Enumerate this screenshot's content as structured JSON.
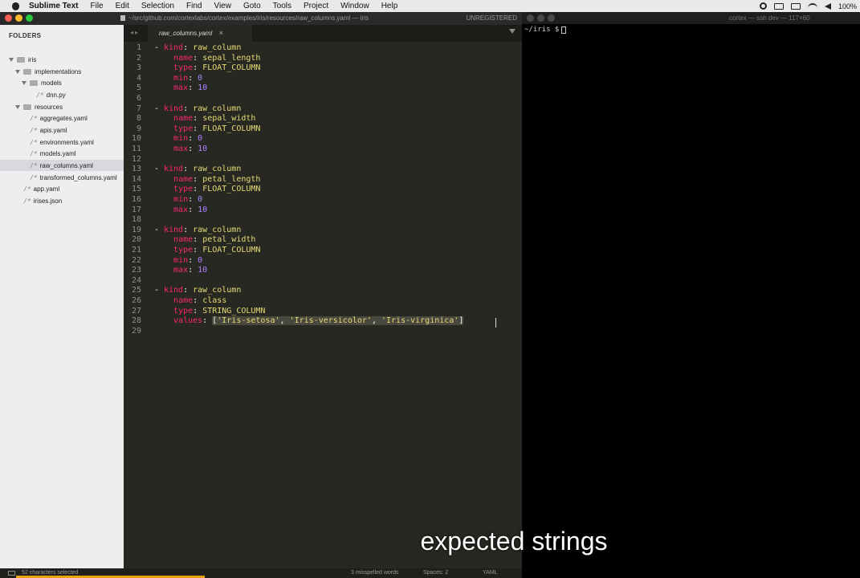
{
  "menubar": {
    "items": [
      "Sublime Text",
      "File",
      "Edit",
      "Selection",
      "Find",
      "View",
      "Goto",
      "Tools",
      "Project",
      "Window",
      "Help"
    ],
    "battery": "100%"
  },
  "sublime": {
    "title": "~/src/github.com/cortexlabs/cortex/examples/iris/resources/raw_columns.yaml — iris",
    "unregistered": "UNREGISTERED",
    "sidebar": {
      "header": "FOLDERS",
      "items": [
        {
          "label": "iris",
          "kind": "folder"
        },
        {
          "label": "implementations",
          "kind": "folder"
        },
        {
          "label": "models",
          "kind": "folder"
        },
        {
          "label": "dnn.py",
          "kind": "file"
        },
        {
          "label": "resources",
          "kind": "folder"
        },
        {
          "label": "aggregates.yaml",
          "kind": "file"
        },
        {
          "label": "apis.yaml",
          "kind": "file"
        },
        {
          "label": "environments.yaml",
          "kind": "file"
        },
        {
          "label": "models.yaml",
          "kind": "file"
        },
        {
          "label": "raw_columns.yaml",
          "kind": "file",
          "selected": true
        },
        {
          "label": "transformed_columns.yaml",
          "kind": "file"
        },
        {
          "label": "app.yaml",
          "kind": "file"
        },
        {
          "label": "irises.json",
          "kind": "file"
        }
      ]
    },
    "tab": {
      "label": "raw_columns.yaml",
      "close": "×"
    },
    "editor": {
      "line_numbers": [
        "1",
        "2",
        "3",
        "4",
        "5",
        "6",
        "7",
        "8",
        "9",
        "10",
        "11",
        "12",
        "13",
        "14",
        "15",
        "16",
        "17",
        "18",
        "19",
        "20",
        "21",
        "22",
        "23",
        "24",
        "25",
        "26",
        "27",
        "28",
        "29"
      ],
      "keys": {
        "kind": "kind",
        "name": "name",
        "type": "type",
        "min": "min",
        "max": "max",
        "values": "values"
      },
      "blocks": [
        {
          "kind": "raw_column",
          "name": "sepal_length",
          "type": "FLOAT_COLUMN",
          "min": "0",
          "max": "10"
        },
        {
          "kind": "raw_column",
          "name": "sepal_width",
          "type": "FLOAT_COLUMN",
          "min": "0",
          "max": "10"
        },
        {
          "kind": "raw_column",
          "name": "petal_length",
          "type": "FLOAT_COLUMN",
          "min": "0",
          "max": "10"
        },
        {
          "kind": "raw_column",
          "name": "petal_width",
          "type": "FLOAT_COLUMN",
          "min": "0",
          "max": "10"
        },
        {
          "kind": "raw_column",
          "name": "class",
          "type": "STRING_COLUMN"
        }
      ],
      "values_line": {
        "open": "[",
        "v1": "'Iris-setosa'",
        "v2": "'Iris-versicolor'",
        "v3": "'Iris-virginica'",
        "close": "]",
        "sep": ", "
      }
    },
    "status": {
      "selection": "52 characters selected",
      "misspelled": "3 misspelled words",
      "spaces": "Spaces: 2",
      "syntax": "YAML"
    }
  },
  "terminal": {
    "title": "cortex — ssh dev — 117×60",
    "prompt": "~/iris $"
  },
  "caption": "expected strings",
  "colors": {
    "editor_bg": "#272822",
    "key": "#f92672",
    "string": "#e6db74",
    "number": "#ae81ff",
    "selection": "#49483e",
    "sidebar_bg": "#eeeef1"
  }
}
